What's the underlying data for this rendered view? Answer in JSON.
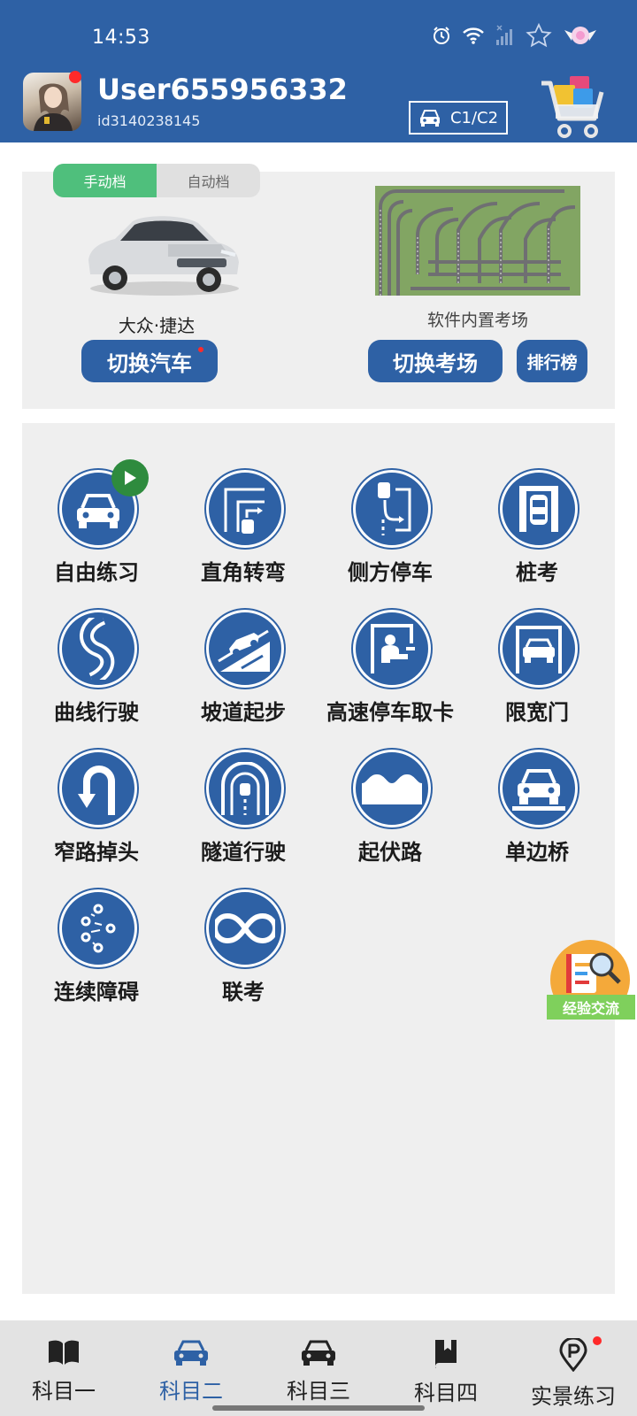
{
  "status_bar": {
    "time": "14:53"
  },
  "user": {
    "name": "User655956332",
    "id": "id3140238145"
  },
  "license": {
    "label": "C1/C2"
  },
  "car_section": {
    "gear_options": [
      "手动档",
      "自动档"
    ],
    "selected_gear": "手动档",
    "car_name": "大众·捷达",
    "switch_car_label": "切换汽车"
  },
  "exam_section": {
    "exam_label": "软件内置考场",
    "switch_exam_label": "切换考场",
    "ranking_label": "排行榜"
  },
  "practice_items": [
    {
      "label": "自由练习",
      "icon": "car-front-icon"
    },
    {
      "label": "直角转弯",
      "icon": "right-angle-turn-icon"
    },
    {
      "label": "侧方停车",
      "icon": "side-parking-icon"
    },
    {
      "label": "桩考",
      "icon": "pile-test-icon"
    },
    {
      "label": "曲线行驶",
      "icon": "s-curve-icon"
    },
    {
      "label": "坡道起步",
      "icon": "ramp-start-icon"
    },
    {
      "label": "高速停车取卡",
      "icon": "toll-booth-icon"
    },
    {
      "label": "限宽门",
      "icon": "width-gate-icon"
    },
    {
      "label": "窄路掉头",
      "icon": "u-turn-icon"
    },
    {
      "label": "隧道行驶",
      "icon": "tunnel-icon"
    },
    {
      "label": "起伏路",
      "icon": "bumpy-road-icon"
    },
    {
      "label": "单边桥",
      "icon": "single-bridge-icon"
    },
    {
      "label": "连续障碍",
      "icon": "obstacles-icon"
    },
    {
      "label": "联考",
      "icon": "infinity-icon"
    }
  ],
  "floating": {
    "label": "经验交流"
  },
  "bottom_nav": [
    {
      "label": "科目一",
      "icon": "book-icon"
    },
    {
      "label": "科目二",
      "icon": "car-icon"
    },
    {
      "label": "科目三",
      "icon": "car-front-icon"
    },
    {
      "label": "科目四",
      "icon": "bookmark-book-icon"
    },
    {
      "label": "实景练习",
      "icon": "parking-pin-icon"
    }
  ],
  "active_nav": "科目二",
  "colors": {
    "primary": "#2e61a5",
    "green": "#4fbf7c",
    "panel": "#efefef",
    "badge": "#ff2a2a"
  }
}
